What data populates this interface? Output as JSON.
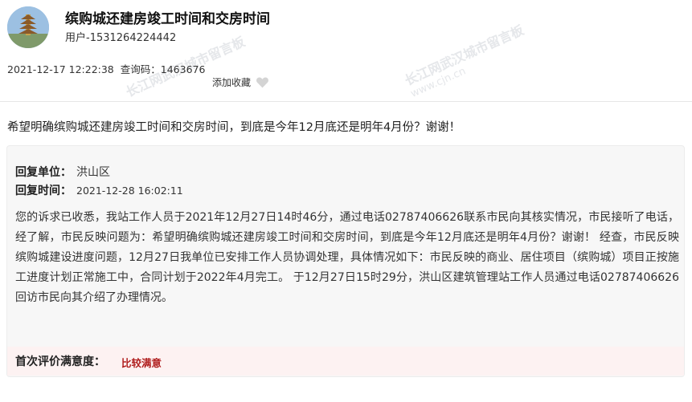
{
  "post": {
    "title": "缤购城还建房竣工时间和交房时间",
    "user": "用户-1531264224442",
    "datetime": "2021-12-17 12:22:38",
    "query_code_label": "查询码：",
    "query_code": "1463676",
    "favorite_label": "添加收藏",
    "question": "希望明确缤购城还建房竣工时间和交房时间，到底是今年12月底还是明年4月份？谢谢！"
  },
  "reply": {
    "unit_label": "回复单位：",
    "unit": "洪山区",
    "time_label": "回复时间：",
    "time": "2021-12-28 16:02:11",
    "content": "您的诉求已收悉，我站工作人员于2021年12月27日14时46分，通过电话02787406626联系市民向其核实情况，市民接听了电话，经了解，市民反映问题为：希望明确缤购城还建房竣工时间和交房时间，到底是今年12月底还是明年4月份？谢谢！ 经查，市民反映缤购城建设进度问题，12月27日我单位已安排工作人员协调处理，具体情况如下：市民反映的商业、居住项目（缤购城）项目正按施工进度计划正常施工中，合同计划于2022年4月完工。 于12月27日15时29分，洪山区建筑管理站工作人员通过电话02787406626回访市民向其介绍了办理情况。"
  },
  "rating": {
    "label": "首次评价满意度：",
    "value": "比较满意",
    "value_color": "#b01e1e"
  },
  "watermark": {
    "text": "长江网武汉城市留言板",
    "url": "www.cjn.cn"
  },
  "icons": {
    "favorite": "heart-icon",
    "avatar": "pagoda-avatar"
  }
}
